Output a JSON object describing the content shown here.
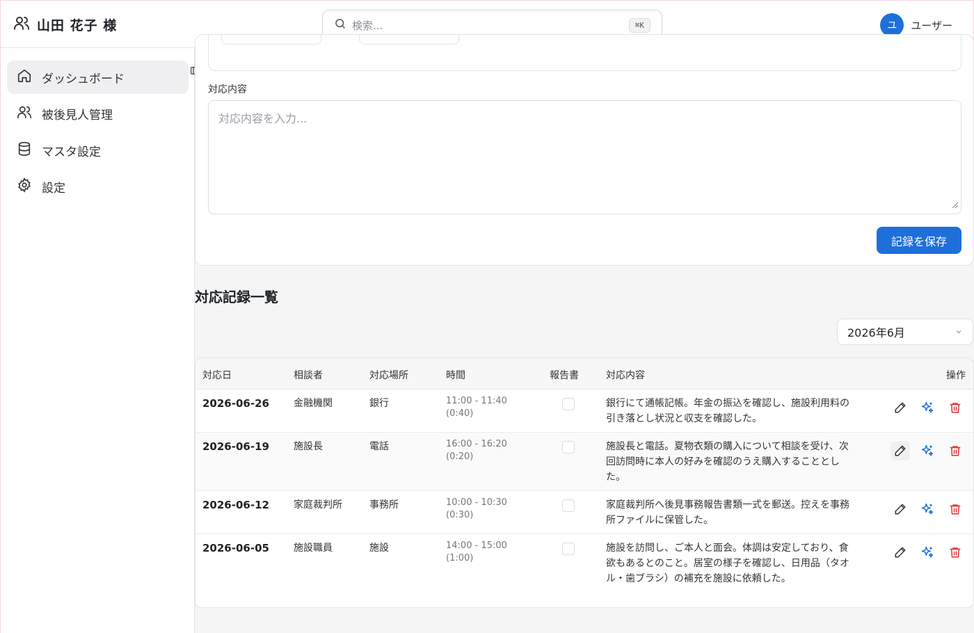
{
  "header": {
    "title": "山田 花子 様",
    "search_placeholder": "検索...",
    "shortcut": "⌘K",
    "user_initial": "ユ",
    "user_name": "ユーザー"
  },
  "sidebar": {
    "items": [
      {
        "label": "ダッシュボード",
        "icon": "home-icon",
        "active": true
      },
      {
        "label": "被後見人管理",
        "icon": "users-icon"
      },
      {
        "label": "マスタ設定",
        "icon": "database-icon"
      },
      {
        "label": "設定",
        "icon": "gear-icon"
      }
    ]
  },
  "form": {
    "content_label": "対応内容",
    "content_placeholder": "対応内容を入力...",
    "save_label": "記録を保存"
  },
  "list": {
    "title": "対応記録一覧",
    "month": "2026年6月",
    "columns": [
      "対応日",
      "相談者",
      "対応場所",
      "時間",
      "報告書",
      "対応内容",
      "操作"
    ],
    "rows": [
      {
        "date": "2026-06-26",
        "person": "金融機関",
        "place": "銀行",
        "time": "11:00 - 11:40",
        "duration": "(0:40)",
        "content": "銀行にて通帳記帳。年金の振込を確認し、施設利用料の引き落とし状況と収支を確認した。"
      },
      {
        "date": "2026-06-19",
        "person": "施設長",
        "place": "電話",
        "time": "16:00 - 16:20",
        "duration": "(0:20)",
        "content": "施設長と電話。夏物衣類の購入について相談を受け、次回訪問時に本人の好みを確認のうえ購入することとした。"
      },
      {
        "date": "2026-06-12",
        "person": "家庭裁判所",
        "place": "事務所",
        "time": "10:00 - 10:30",
        "duration": "(0:30)",
        "content": "家庭裁判所へ後見事務報告書類一式を郵送。控えを事務所ファイルに保管した。"
      },
      {
        "date": "2026-06-05",
        "person": "施設職員",
        "place": "施設",
        "time": "14:00 - 15:00",
        "duration": "(1:00)",
        "content": "施設を訪問し、ご本人と面会。体調は安定しており、食欲もあるとのこと。居室の様子を確認し、日用品（タオル・歯ブラシ）の補充を施設に依頼した。"
      }
    ]
  },
  "colors": {
    "accent": "#1e6fd9",
    "danger": "#e03131"
  }
}
